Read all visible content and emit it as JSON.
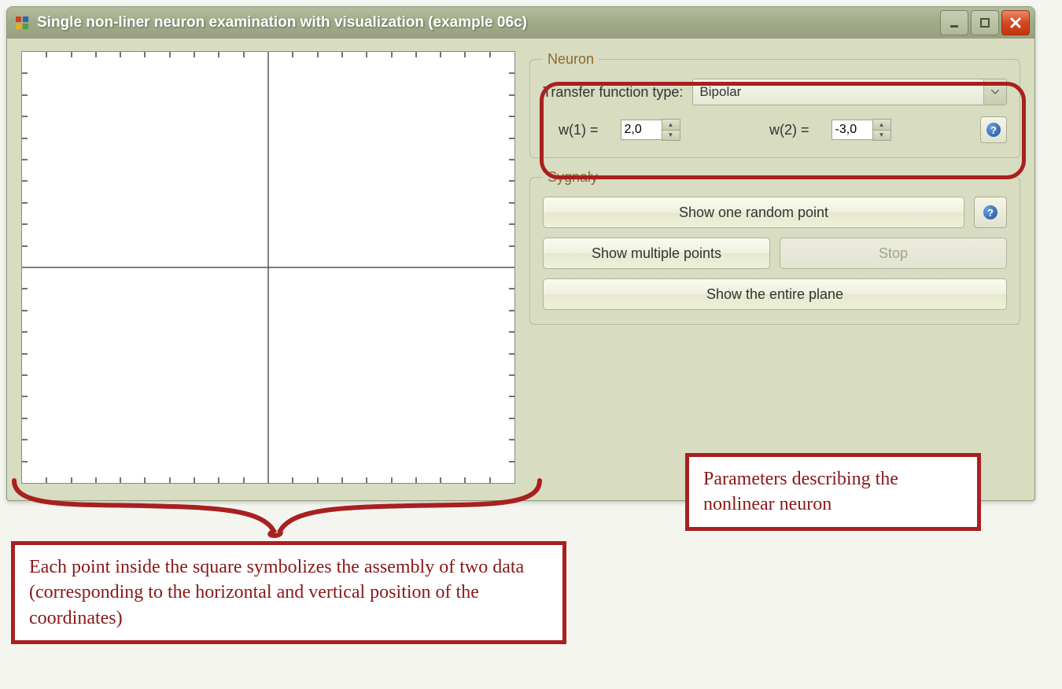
{
  "window": {
    "title": "Single non-liner neuron examination with visualization (example 06c)"
  },
  "neuron": {
    "legend": "Neuron",
    "transfer_label": "Transfer function type:",
    "transfer_value": "Bipolar",
    "w1_label": "w(1) =",
    "w1_value": "2,0",
    "w2_label": "w(2) =",
    "w2_value": "-3,0"
  },
  "signals": {
    "legend": "Sygnały",
    "btn_random": "Show one random point",
    "btn_multi": "Show multiple points",
    "btn_stop": "Stop",
    "btn_plane": "Show the entire plane"
  },
  "callouts": {
    "params": "Parameters describing the nonlinear neuron",
    "plot": "Each point inside the square symbolizes the assembly of two data (corresponding to the horizontal and vertical position of the coordinates)"
  }
}
